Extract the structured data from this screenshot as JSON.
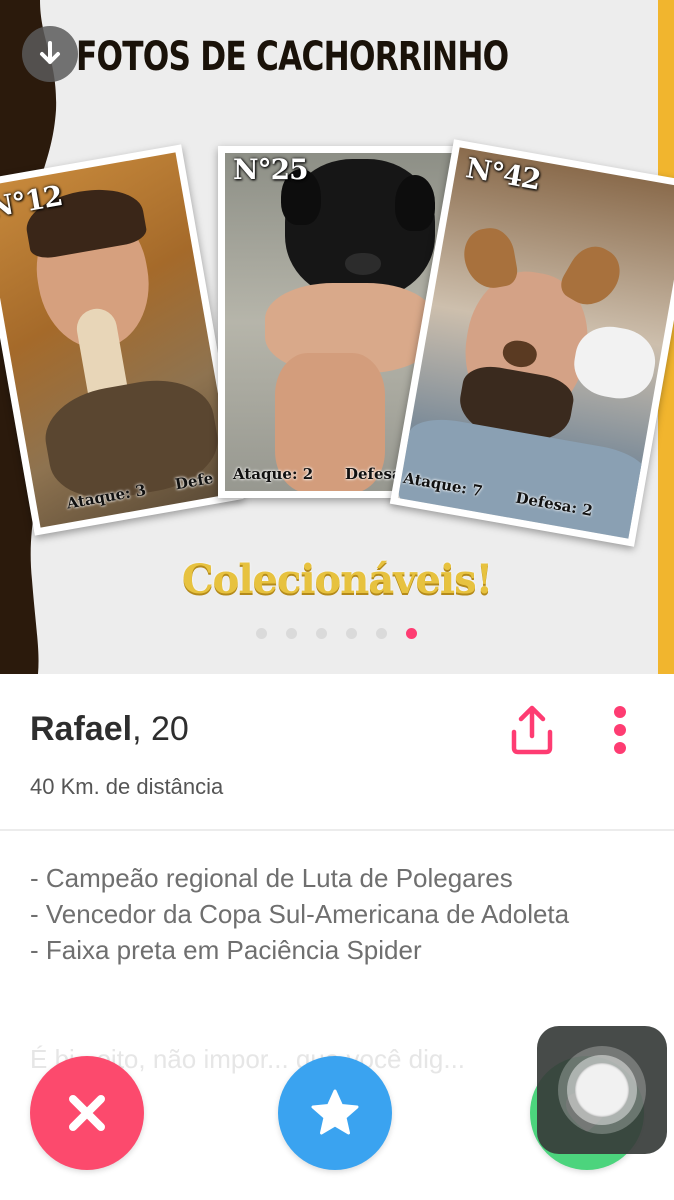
{
  "photo": {
    "title": "FOTOS DE CACHORRINHO",
    "caption": "Colecionáveis!",
    "cards": [
      {
        "number": "N°12",
        "attack": "Ataque: 3",
        "defense": "Defe"
      },
      {
        "number": "N°25",
        "attack": "Ataque: 2",
        "defense": "Defesa"
      },
      {
        "number": "N°42",
        "attack": "Ataque: 7",
        "defense": "Defesa: 2"
      }
    ],
    "photo_count": 6,
    "active_photo_index": 5
  },
  "profile": {
    "name": "Rafael",
    "age_text": ", 20",
    "distance": "40 Km. de distância",
    "bio_lines": [
      "- Campeão regional de Luta de Polegares",
      "- Vencedor da Copa Sul-Americana de Adoleta",
      "- Faixa preta em Paciência Spider"
    ],
    "bio_faded": "É bi...oito, não impor... que você dig..."
  },
  "actions": {
    "nope_icon": "close-icon",
    "super_like_icon": "star-icon",
    "like_icon": "heart-icon",
    "share_icon": "share-icon",
    "more_icon": "more-vertical-icon"
  },
  "colors": {
    "brand_pink": "#fe3c72",
    "nope_red": "#fc4a6d",
    "star_blue": "#3aa3f0",
    "like_green": "#4cd47d",
    "caption_gold": "#e7c23f",
    "brown": "#2b1a0c",
    "gold_strip": "#f1b52e"
  }
}
